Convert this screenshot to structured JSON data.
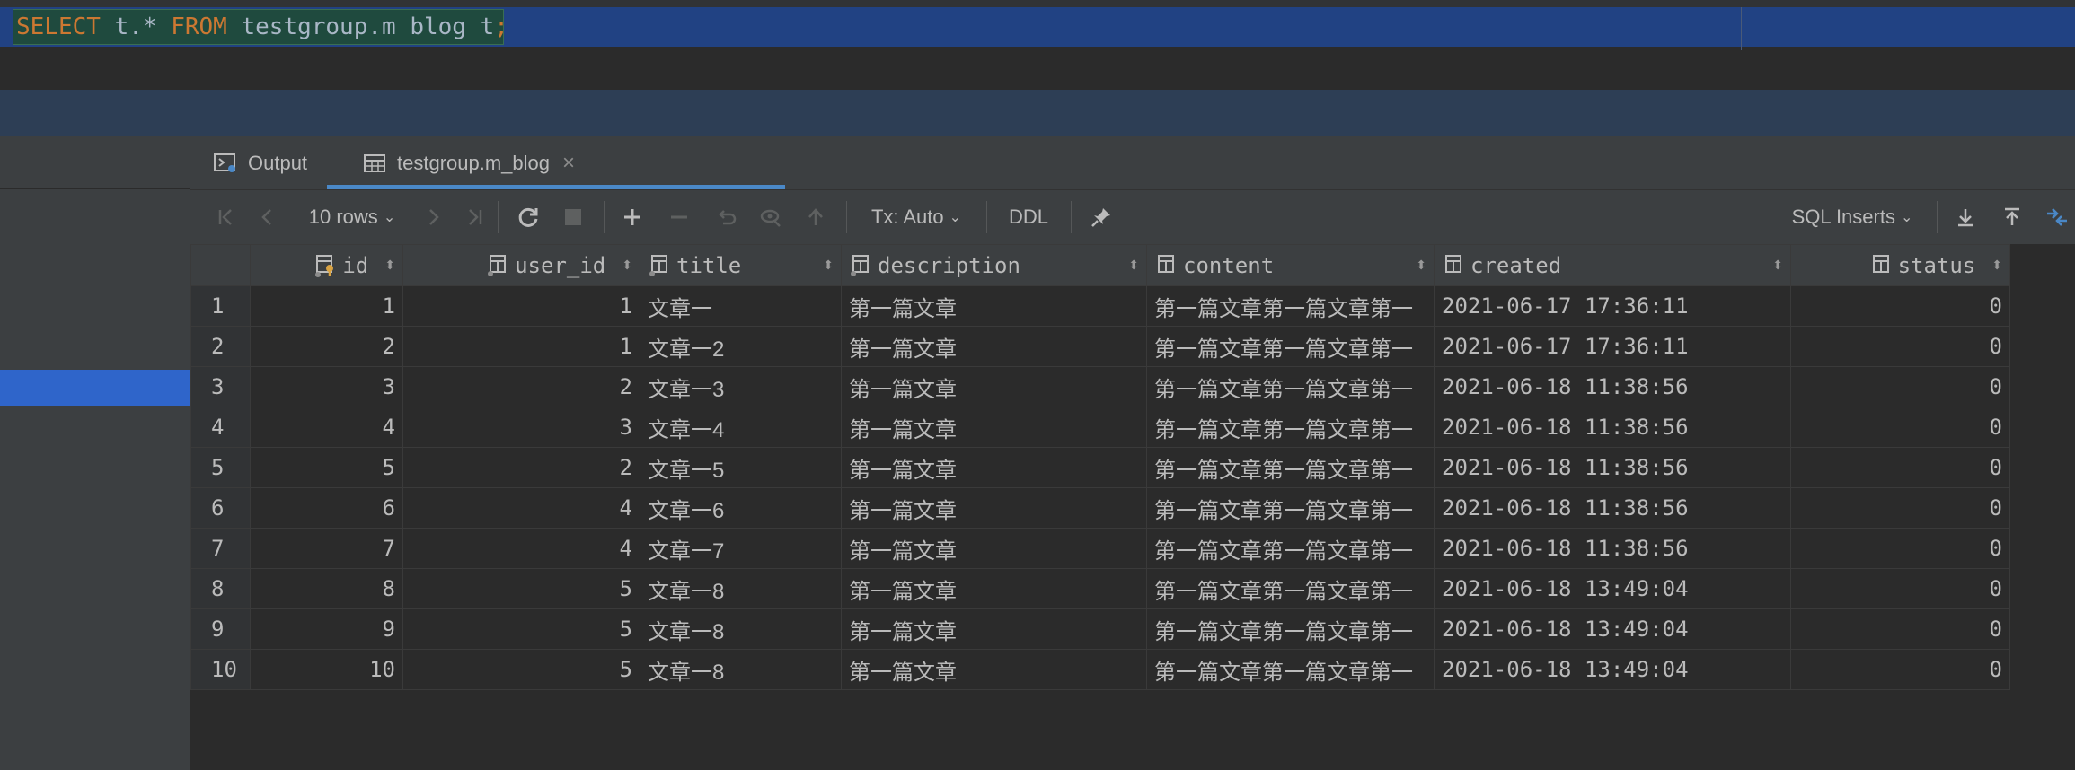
{
  "editor": {
    "tokens": {
      "select": "SELECT",
      "star": " t.* ",
      "from": "FROM",
      "table": " testgroup.m_blog t",
      "semi": ";"
    }
  },
  "results": {
    "tabs": [
      {
        "label": "Output"
      },
      {
        "label": "testgroup.m_blog"
      }
    ],
    "toolbar": {
      "rows_label": "10 rows",
      "tx_label": "Tx: Auto",
      "ddl_label": "DDL",
      "export_label": "SQL Inserts"
    },
    "columns": [
      "id",
      "user_id",
      "title",
      "description",
      "content",
      "created",
      "status"
    ],
    "rows": [
      [
        "1",
        "1",
        "1",
        "文章一",
        "第一篇文章",
        "第一篇文章第一篇文章第一",
        "2021-06-17 17:36:11",
        "0"
      ],
      [
        "2",
        "2",
        "1",
        "文章一2",
        "第一篇文章",
        "第一篇文章第一篇文章第一",
        "2021-06-17 17:36:11",
        "0"
      ],
      [
        "3",
        "3",
        "2",
        "文章一3",
        "第一篇文章",
        "第一篇文章第一篇文章第一",
        "2021-06-18 11:38:56",
        "0"
      ],
      [
        "4",
        "4",
        "3",
        "文章一4",
        "第一篇文章",
        "第一篇文章第一篇文章第一",
        "2021-06-18 11:38:56",
        "0"
      ],
      [
        "5",
        "5",
        "2",
        "文章一5",
        "第一篇文章",
        "第一篇文章第一篇文章第一",
        "2021-06-18 11:38:56",
        "0"
      ],
      [
        "6",
        "6",
        "4",
        "文章一6",
        "第一篇文章",
        "第一篇文章第一篇文章第一",
        "2021-06-18 11:38:56",
        "0"
      ],
      [
        "7",
        "7",
        "4",
        "文章一7",
        "第一篇文章",
        "第一篇文章第一篇文章第一",
        "2021-06-18 11:38:56",
        "0"
      ],
      [
        "8",
        "8",
        "5",
        "文章一8",
        "第一篇文章",
        "第一篇文章第一篇文章第一",
        "2021-06-18 13:49:04",
        "0"
      ],
      [
        "9",
        "9",
        "5",
        "文章一8",
        "第一篇文章",
        "第一篇文章第一篇文章第一",
        "2021-06-18 13:49:04",
        "0"
      ],
      [
        "10",
        "10",
        "5",
        "文章一8",
        "第一篇文章",
        "第一篇文章第一篇文章第一",
        "2021-06-18 13:49:04",
        "0"
      ]
    ]
  },
  "colors": {
    "keyword": "#cc7832",
    "editor_bg": "#2b2b2b",
    "selection": "#214283",
    "panel": "#3c3f41",
    "tab_underline": "#4a88c7",
    "left_selected": "#2f65ca"
  },
  "icons": [
    "output-icon",
    "table-icon",
    "close-icon",
    "first-page-icon",
    "prev-page-icon",
    "next-page-icon",
    "last-page-icon",
    "refresh-icon",
    "stop-icon",
    "add-row-icon",
    "remove-row-icon",
    "revert-icon",
    "preview-icon",
    "submit-icon",
    "pin-icon",
    "download-icon",
    "upload-icon",
    "compare-icon",
    "column-icon",
    "key-icon"
  ]
}
